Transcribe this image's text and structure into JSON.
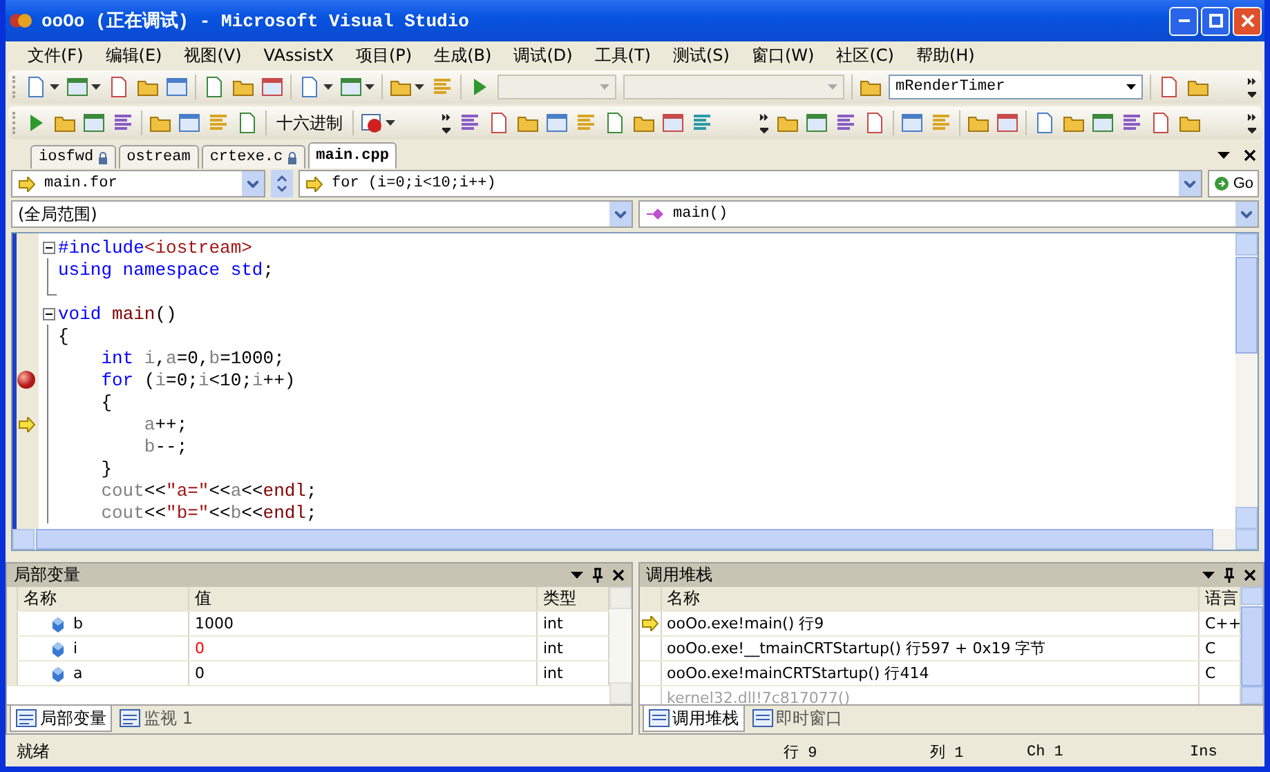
{
  "window": {
    "title": "ooOo (正在调试) - Microsoft Visual Studio"
  },
  "menu": [
    "文件(F)",
    "编辑(E)",
    "视图(V)",
    "VAssistX",
    "项目(P)",
    "生成(B)",
    "调试(D)",
    "工具(T)",
    "测试(S)",
    "窗口(W)",
    "社区(C)",
    "帮助(H)"
  ],
  "toolbars": [
    {
      "items": [
        {
          "kind": "icon"
        },
        {
          "kind": "dropdown"
        },
        {
          "kind": "icon"
        },
        {
          "kind": "dropdown"
        },
        {
          "kind": "icon"
        },
        {
          "kind": "icon"
        },
        {
          "kind": "icon"
        },
        {
          "kind": "sep"
        },
        {
          "kind": "icon"
        },
        {
          "kind": "icon"
        },
        {
          "kind": "icon"
        },
        {
          "kind": "sep"
        },
        {
          "kind": "icon"
        },
        {
          "kind": "dropdown"
        },
        {
          "kind": "icon"
        },
        {
          "kind": "dropdown"
        },
        {
          "kind": "sep"
        },
        {
          "kind": "icon"
        },
        {
          "kind": "dropdown"
        },
        {
          "kind": "icon"
        },
        {
          "kind": "sep"
        },
        {
          "kind": "play"
        },
        {
          "kind": "combo"
        },
        {
          "kind": "combo"
        },
        {
          "kind": "sep"
        },
        {
          "kind": "icon"
        },
        {
          "kind": "combo",
          "value": "mRenderTimer"
        },
        {
          "kind": "sep"
        },
        {
          "kind": "icon"
        },
        {
          "kind": "icon"
        },
        {
          "kind": "overflow"
        }
      ]
    },
    {
      "items": [
        {
          "kind": "play"
        },
        {
          "kind": "icon"
        },
        {
          "kind": "icon"
        },
        {
          "kind": "icon"
        },
        {
          "kind": "sep"
        },
        {
          "kind": "icon"
        },
        {
          "kind": "icon"
        },
        {
          "kind": "icon"
        },
        {
          "kind": "icon"
        },
        {
          "kind": "sep"
        },
        {
          "kind": "text",
          "label": "十六进制"
        },
        {
          "kind": "sep"
        },
        {
          "kind": "record"
        },
        {
          "kind": "dropdown"
        },
        {
          "kind": "overflow"
        },
        {
          "kind": "icon"
        },
        {
          "kind": "icon"
        },
        {
          "kind": "icon"
        },
        {
          "kind": "icon"
        },
        {
          "kind": "icon"
        },
        {
          "kind": "icon"
        },
        {
          "kind": "icon"
        },
        {
          "kind": "icon"
        },
        {
          "kind": "icon"
        },
        {
          "kind": "overflow"
        },
        {
          "kind": "icon"
        },
        {
          "kind": "icon"
        },
        {
          "kind": "icon"
        },
        {
          "kind": "icon"
        },
        {
          "kind": "sep"
        },
        {
          "kind": "icon"
        },
        {
          "kind": "icon"
        },
        {
          "kind": "sep"
        },
        {
          "kind": "icon"
        },
        {
          "kind": "icon"
        },
        {
          "kind": "sep"
        },
        {
          "kind": "icon"
        },
        {
          "kind": "icon"
        },
        {
          "kind": "icon"
        },
        {
          "kind": "icon"
        },
        {
          "kind": "icon"
        },
        {
          "kind": "icon"
        },
        {
          "kind": "overflow"
        }
      ]
    }
  ],
  "doc_tabs": [
    {
      "label": "iosfwd",
      "locked": true,
      "selected": false
    },
    {
      "label": "ostream",
      "locked": false,
      "selected": false
    },
    {
      "label": "crtexe.c",
      "locked": true,
      "selected": false
    },
    {
      "label": "main.cpp",
      "locked": false,
      "selected": true
    }
  ],
  "navigation": {
    "statement": "main.for",
    "location": "for (i=0;i<10;i++)",
    "go_label": "Go",
    "scope": "(全局范围)",
    "member": "main()"
  },
  "code": [
    {
      "kind": "block-start",
      "breakpoint": false,
      "current": false,
      "tokens": [
        {
          "kind": "directive",
          "text": "#include"
        },
        {
          "kind": "string",
          "text": "<iostream>"
        }
      ]
    },
    {
      "kind": "block-body",
      "breakpoint": false,
      "current": false,
      "tokens": [
        {
          "kind": "keyword",
          "text": "using namespace std"
        },
        {
          "kind": "plain",
          "text": ";"
        }
      ]
    },
    {
      "kind": "block-end",
      "breakpoint": false,
      "current": false
    },
    {
      "kind": "block-start",
      "breakpoint": false,
      "current": false,
      "tokens": [
        {
          "kind": "keyword",
          "text": "void"
        },
        {
          "kind": "function",
          "text": " main"
        },
        {
          "kind": "plain",
          "text": "()"
        }
      ]
    },
    {
      "kind": "block-body",
      "breakpoint": false,
      "current": false,
      "tokens": [
        {
          "kind": "plain",
          "text": "{"
        }
      ]
    },
    {
      "kind": "block-body",
      "breakpoint": false,
      "current": false,
      "tokens": [
        {
          "kind": "keyword",
          "text": "    int"
        },
        {
          "kind": "variable",
          "text": " i"
        },
        {
          "kind": "plain",
          "text": ","
        },
        {
          "kind": "variable",
          "text": "a"
        },
        {
          "kind": "plain",
          "text": "=0,"
        },
        {
          "kind": "variable",
          "text": "b"
        },
        {
          "kind": "plain",
          "text": "=1000;"
        }
      ]
    },
    {
      "kind": "block-body",
      "breakpoint": true,
      "current": false,
      "tokens": [
        {
          "kind": "keyword",
          "text": "    for"
        },
        {
          "kind": "plain",
          "text": " ("
        },
        {
          "kind": "variable",
          "text": "i"
        },
        {
          "kind": "plain",
          "text": "=0;"
        },
        {
          "kind": "variable",
          "text": "i"
        },
        {
          "kind": "plain",
          "text": "<10;"
        },
        {
          "kind": "variable",
          "text": "i"
        },
        {
          "kind": "plain",
          "text": "++)"
        }
      ]
    },
    {
      "kind": "block-body",
      "breakpoint": false,
      "current": false,
      "tokens": [
        {
          "kind": "plain",
          "text": "    {"
        }
      ]
    },
    {
      "kind": "block-body",
      "breakpoint": false,
      "current": true,
      "tokens": [
        {
          "kind": "variable",
          "text": "        a"
        },
        {
          "kind": "plain",
          "text": "++;"
        }
      ]
    },
    {
      "kind": "block-body",
      "breakpoint": false,
      "current": false,
      "tokens": [
        {
          "kind": "variable",
          "text": "        b"
        },
        {
          "kind": "plain",
          "text": "--;"
        }
      ]
    },
    {
      "kind": "block-body",
      "breakpoint": false,
      "current": false,
      "tokens": [
        {
          "kind": "plain",
          "text": "    }"
        }
      ]
    },
    {
      "kind": "block-body",
      "breakpoint": false,
      "current": false,
      "tokens": [
        {
          "kind": "variable",
          "text": "    cout"
        },
        {
          "kind": "plain",
          "text": "<<"
        },
        {
          "kind": "string",
          "text": "\"a=\""
        },
        {
          "kind": "plain",
          "text": "<<"
        },
        {
          "kind": "variable",
          "text": "a"
        },
        {
          "kind": "plain",
          "text": "<<"
        },
        {
          "kind": "function",
          "text": "endl"
        },
        {
          "kind": "plain",
          "text": ";"
        }
      ]
    },
    {
      "kind": "block-body",
      "breakpoint": false,
      "current": false,
      "tokens": [
        {
          "kind": "variable",
          "text": "    cout"
        },
        {
          "kind": "plain",
          "text": "<<"
        },
        {
          "kind": "string",
          "text": "\"b=\""
        },
        {
          "kind": "plain",
          "text": "<<"
        },
        {
          "kind": "variable",
          "text": "b"
        },
        {
          "kind": "plain",
          "text": "<<"
        },
        {
          "kind": "function",
          "text": "endl"
        },
        {
          "kind": "plain",
          "text": ";"
        }
      ]
    }
  ],
  "locals": {
    "title": "局部变量",
    "columns": [
      "名称",
      "值",
      "类型"
    ],
    "rows": [
      {
        "name": "b",
        "value": "1000",
        "type": "int",
        "changed": false
      },
      {
        "name": "i",
        "value": "0",
        "type": "int",
        "changed": true
      },
      {
        "name": "a",
        "value": "0",
        "type": "int",
        "changed": false
      }
    ],
    "tabs": [
      {
        "label": "局部变量",
        "selected": true
      },
      {
        "label": "监视 1",
        "selected": false
      }
    ]
  },
  "call_stack": {
    "title": "调用堆栈",
    "columns": [
      "名称",
      "语言"
    ],
    "rows": [
      {
        "name": "ooOo.exe!main() 行9",
        "language": "C++",
        "current": true,
        "dimmed": false
      },
      {
        "name": "ooOo.exe!__tmainCRTStartup() 行597 + 0x19 字节",
        "language": "C",
        "current": false,
        "dimmed": false
      },
      {
        "name": "ooOo.exe!mainCRTStartup() 行414",
        "language": "C",
        "current": false,
        "dimmed": false
      },
      {
        "name": "kernel32.dll!7c817077()",
        "current": false,
        "dimmed": true
      }
    ],
    "tabs": [
      {
        "label": "调用堆栈",
        "selected": true
      },
      {
        "label": "即时窗口",
        "selected": false
      }
    ]
  },
  "status_bar": {
    "message": "就绪",
    "line": "行 9",
    "column": "列 1",
    "char": "Ch 1",
    "mode": "Ins"
  }
}
